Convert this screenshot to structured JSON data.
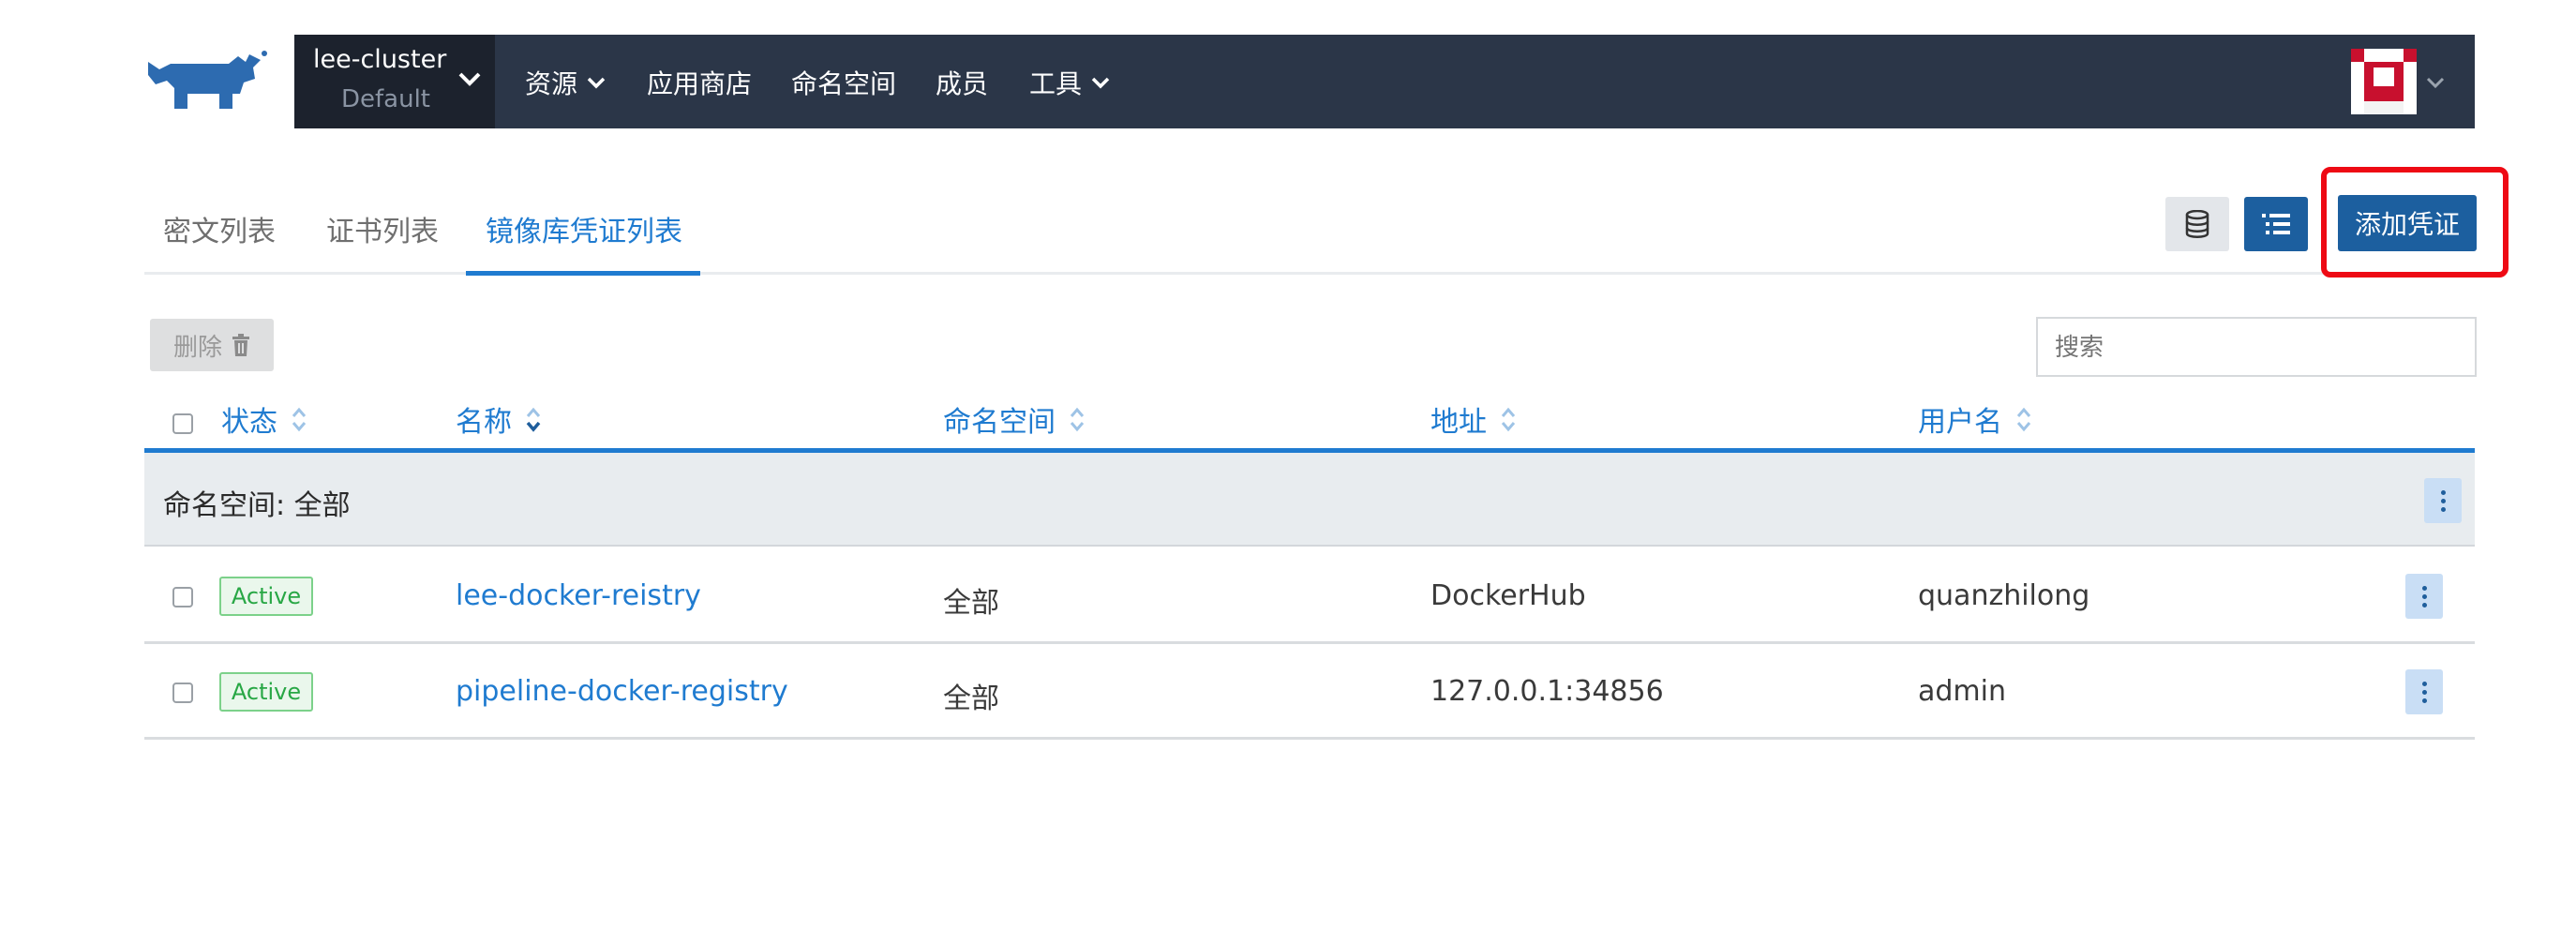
{
  "nav": {
    "cluster_name": "lee-cluster",
    "project_name": "Default",
    "items": [
      "资源",
      "应用商店",
      "命名空间",
      "成员",
      "工具"
    ]
  },
  "tabs": [
    "密文列表",
    "证书列表",
    "镜像库凭证列表"
  ],
  "actions": {
    "add_label": "添加凭证",
    "delete_label": "删除"
  },
  "search": {
    "placeholder": "搜索"
  },
  "table": {
    "columns": [
      "状态",
      "名称",
      "命名空间",
      "地址",
      "用户名"
    ],
    "group_label": "命名空间: 全部",
    "rows": [
      {
        "status": "Active",
        "name": "lee-docker-reistry",
        "namespace": "全部",
        "address": "DockerHub",
        "username": "quanzhilong"
      },
      {
        "status": "Active",
        "name": "pipeline-docker-registry",
        "namespace": "全部",
        "address": "127.0.0.1:34856",
        "username": "admin"
      }
    ]
  },
  "colors": {
    "navbar": "#2b3648",
    "accent": "#1f7bd0",
    "primary_button": "#1c5f9f",
    "highlight": "#ee0a14",
    "active_badge": "#28a745"
  }
}
